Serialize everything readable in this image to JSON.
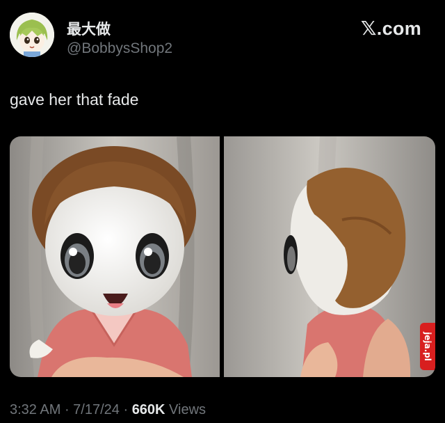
{
  "author": {
    "display_name": "最大做",
    "handle": "@BobbysShop2",
    "avatar_icon": "cartoon-girl-avatar-icon"
  },
  "brand": {
    "label": ".com",
    "logo_icon": "x-logo-icon",
    "logo_glyph": "𝕏"
  },
  "tweet": {
    "text": "gave her that fade"
  },
  "media": {
    "photos": [
      {
        "description_icon": "plush-doll-front-photo"
      },
      {
        "description_icon": "plush-doll-side-photo"
      }
    ]
  },
  "watermark": {
    "text": "jeja.pl",
    "color": "#d81f1f"
  },
  "meta": {
    "time": "3:32 AM",
    "sep1": " · ",
    "date": "7/17/24",
    "sep2": " · ",
    "views_count": "660K",
    "views_label": " Views"
  },
  "colors": {
    "background": "#000000",
    "primary_text": "#e7e9ea",
    "secondary_text": "#71767b"
  }
}
